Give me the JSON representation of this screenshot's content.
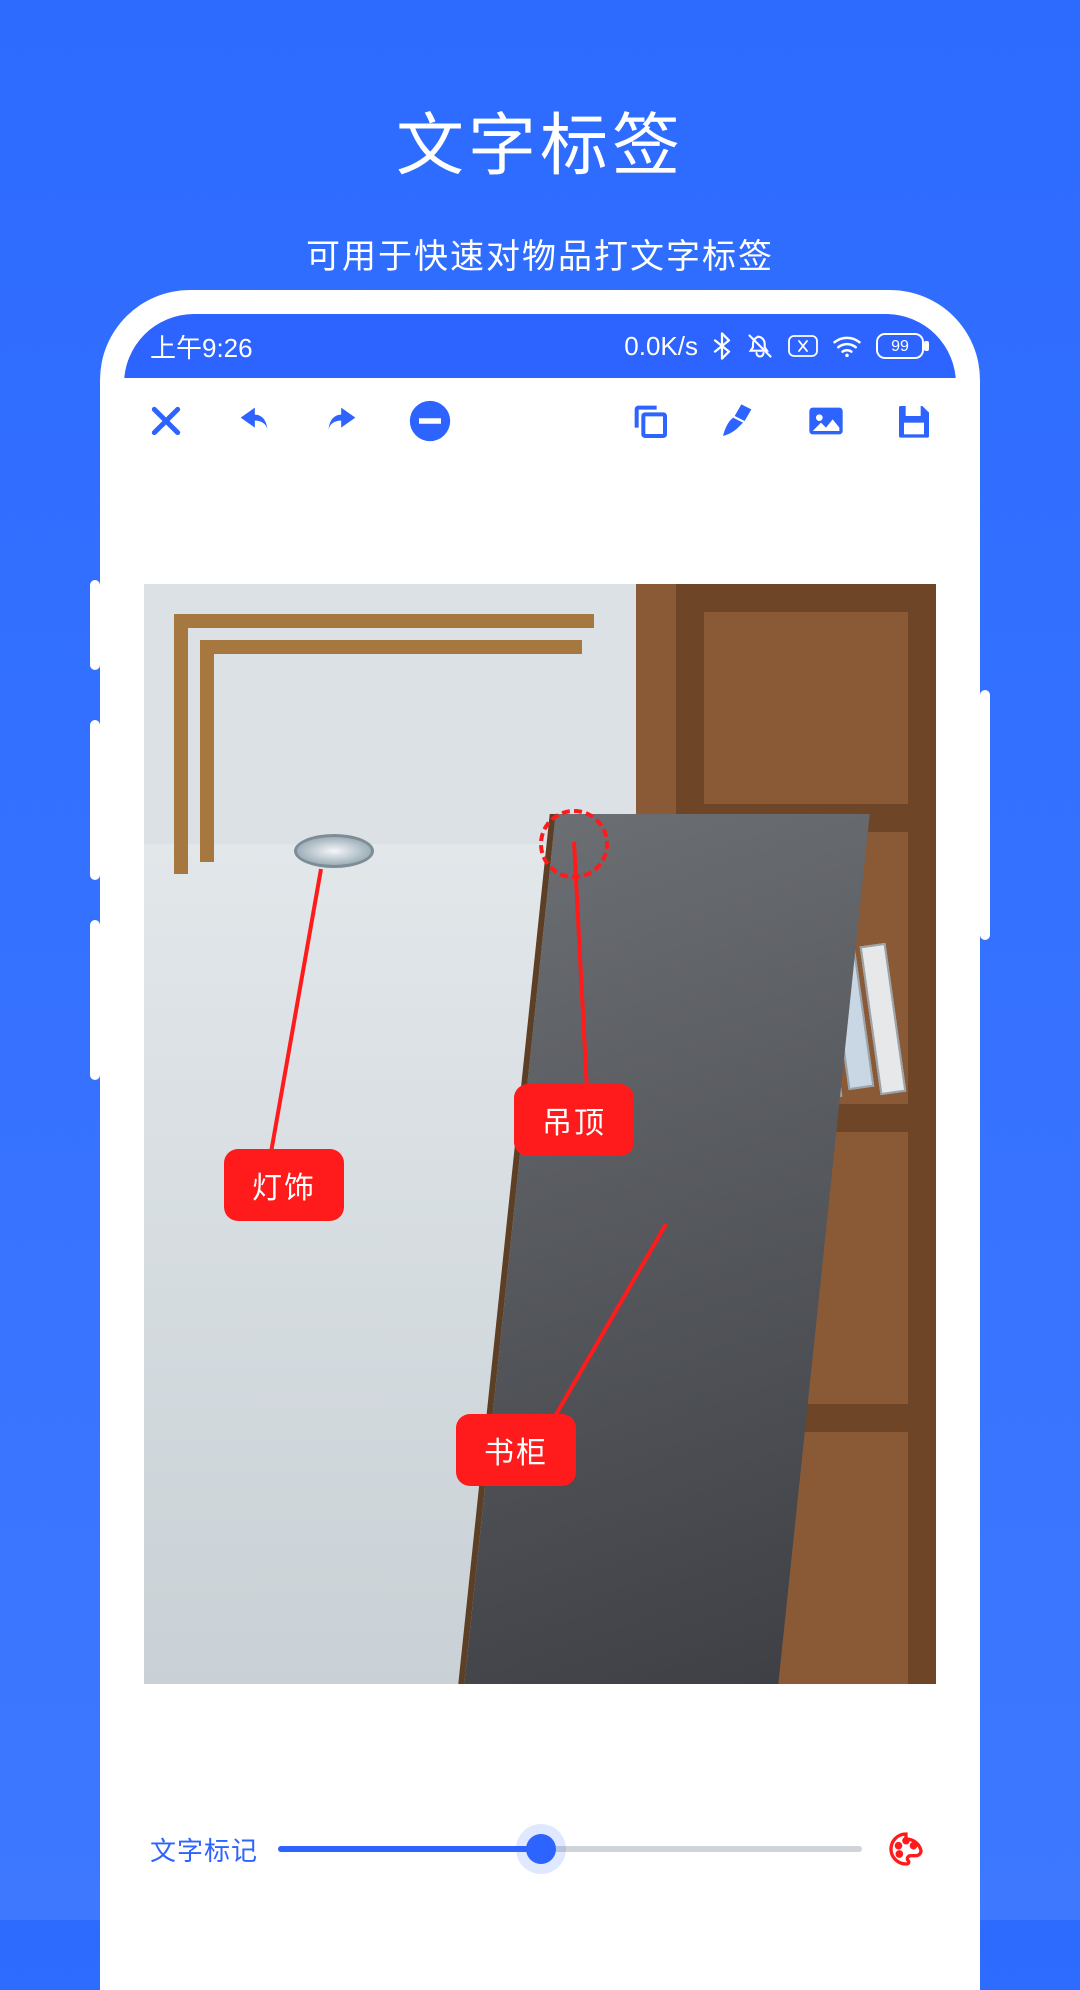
{
  "promo": {
    "title": "文字标签",
    "subtitle": "可用于快速对物品打文字标签"
  },
  "statusbar": {
    "time": "上午9:26",
    "net_speed": "0.0K/s",
    "battery": "99"
  },
  "toolbar": {
    "close": "close",
    "undo": "undo",
    "redo": "redo",
    "minus": "minus",
    "copy": "copy",
    "clean": "clean",
    "image": "image",
    "save": "save"
  },
  "annotations": {
    "lamp": "灯饰",
    "ceiling": "吊顶",
    "shelf": "书柜"
  },
  "footer": {
    "mode_label": "文字标记",
    "slider_percent": 45
  },
  "colors": {
    "accent": "#2d63ff",
    "tag": "#ff1b1b"
  }
}
